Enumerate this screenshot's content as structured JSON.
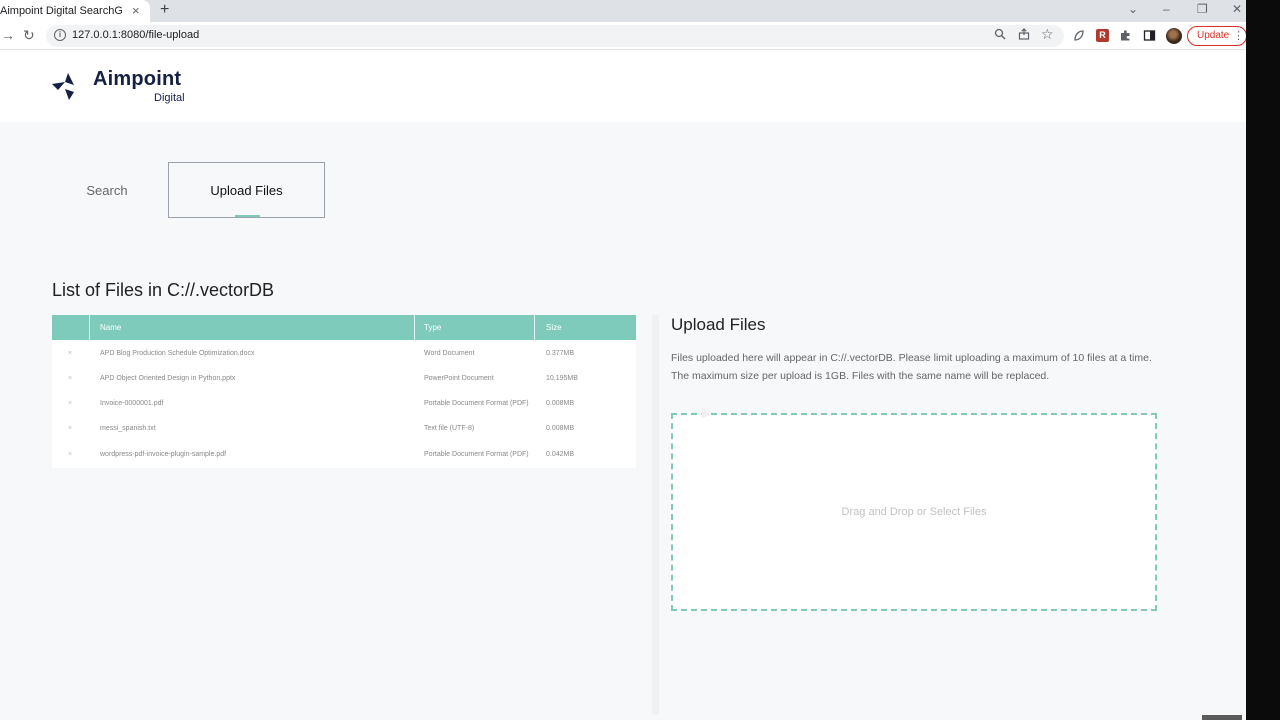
{
  "browser": {
    "tab_title": "Aimpoint Digital SearchGPT",
    "tab_close": "×",
    "new_tab": "+",
    "url": "127.0.0.1:8080/file-upload",
    "update_label": "Update",
    "back": "→",
    "reload": "↻",
    "info": "i",
    "menu": "⋮"
  },
  "header": {
    "brand": "Aimpoint",
    "brand_sub": "Digital"
  },
  "nav": {
    "search": "Search",
    "upload": "Upload Files"
  },
  "file_list": {
    "title": "List of Files in C://.vectorDB",
    "columns": [
      "Name",
      "Type",
      "Size"
    ],
    "delete_glyph": "×",
    "rows": [
      {
        "name": "APD Blog Production Schedule Optimization.docx",
        "type": "Word Document",
        "size": "0.377MB"
      },
      {
        "name": "APD Object Oriented Design in Python.pptx",
        "type": "PowerPoint Document",
        "size": "10.195MB"
      },
      {
        "name": "Invoice-0000001.pdf",
        "type": "Portable Document Format (PDF)",
        "size": "0.008MB"
      },
      {
        "name": "messi_spanish.txt",
        "type": "Text file (UTF-8)",
        "size": "0.008MB"
      },
      {
        "name": "wordpress-pdf-invoice-plugin-sample.pdf",
        "type": "Portable Document Format (PDF)",
        "size": "0.042MB"
      }
    ]
  },
  "upload": {
    "title": "Upload Files",
    "description": "Files uploaded here will appear in C://.vectorDB. Please limit uploading a maximum of 10 files at a time. The maximum size per upload is 1GB. Files with the same name will be replaced.",
    "dropzone_label": "Drag and Drop or Select Files"
  },
  "colors": {
    "accent": "#7ecbbb",
    "brand_navy": "#152042"
  }
}
